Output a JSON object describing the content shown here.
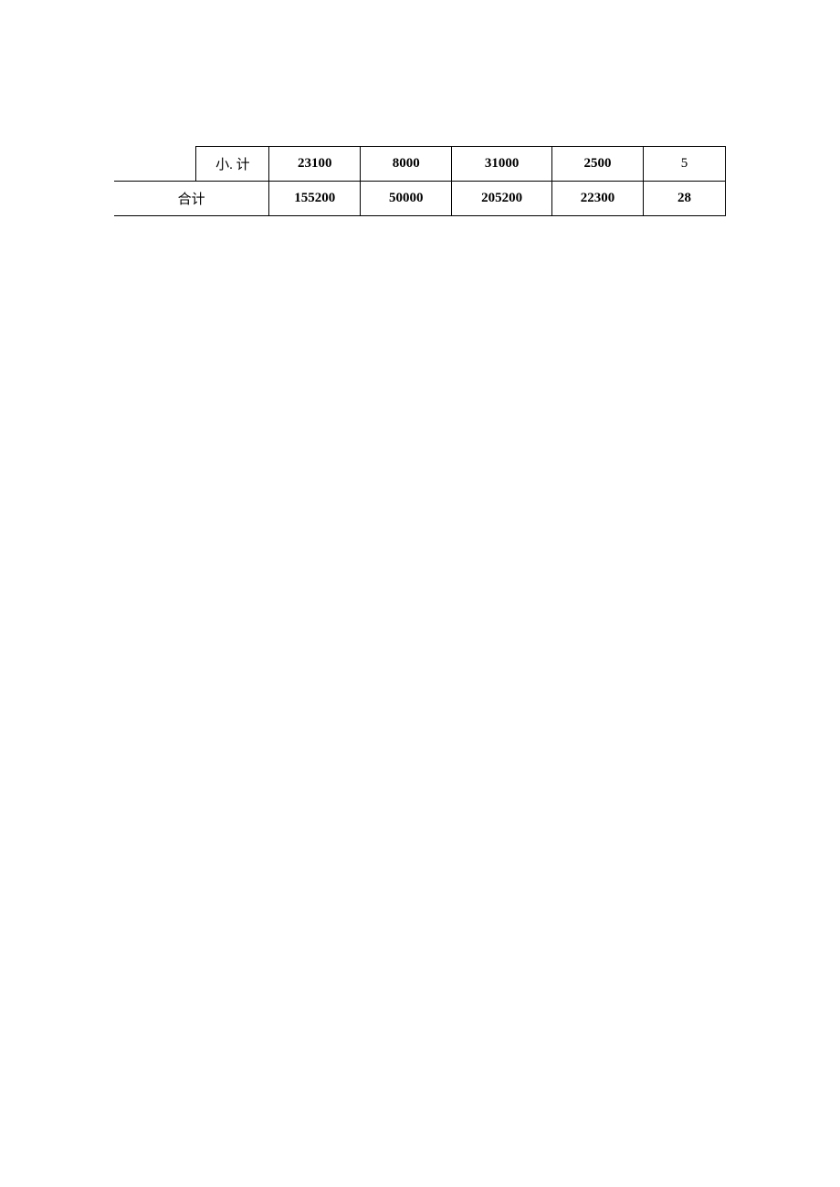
{
  "table": {
    "row1": {
      "label": "小. 计",
      "v1": "23100",
      "v2": "8000",
      "v3": "31000",
      "v4": "2500",
      "v5": "5"
    },
    "row2": {
      "label": "合计",
      "v1": "155200",
      "v2": "50000",
      "v3": "205200",
      "v4": "22300",
      "v5": "28"
    }
  }
}
